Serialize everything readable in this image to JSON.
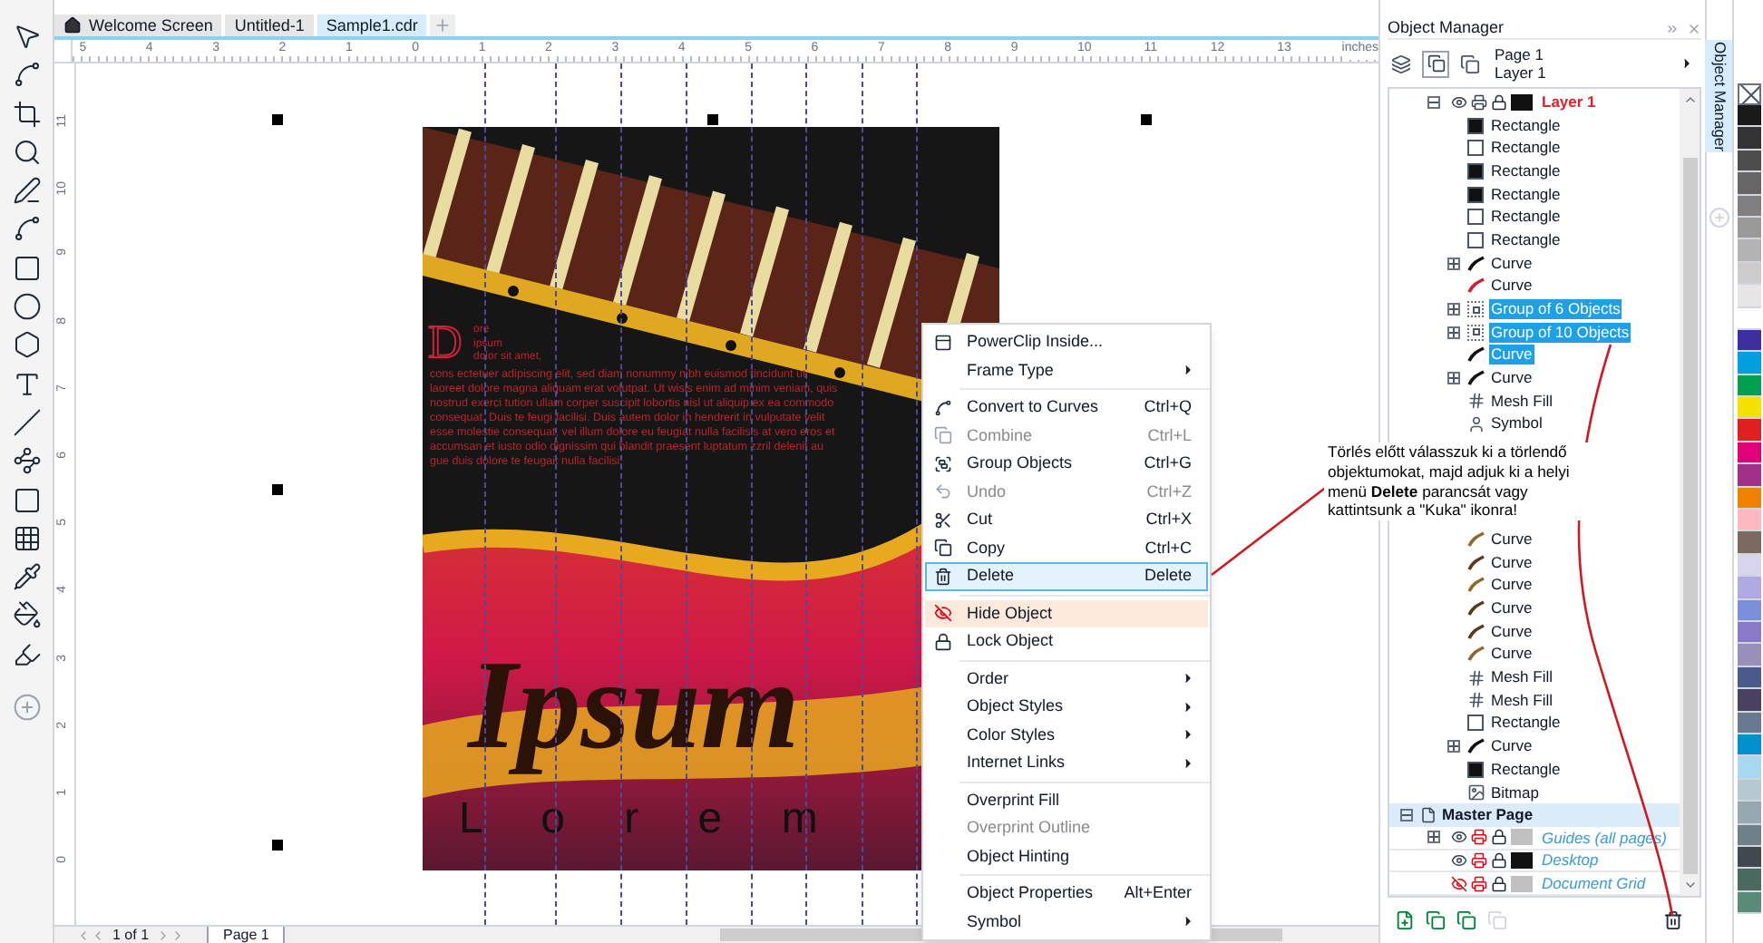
{
  "tabs": [
    {
      "label": "Welcome Screen",
      "selected": false
    },
    {
      "label": "Untitled-1",
      "selected": false
    },
    {
      "label": "Sample1.cdr",
      "selected": true
    }
  ],
  "ruler": {
    "horizontal": [
      "5",
      "4",
      "3",
      "2",
      "1",
      "0",
      "1",
      "2",
      "3",
      "4",
      "5",
      "6",
      "7",
      "8",
      "9",
      "10",
      "11",
      "12",
      "13"
    ],
    "unit": "inches",
    "vertical": [
      "11",
      "10",
      "9",
      "8",
      "7",
      "6",
      "5",
      "4",
      "3",
      "2",
      "1",
      "0"
    ]
  },
  "artwork": {
    "drop_cap": "D",
    "intro": [
      "ore",
      "ipsum",
      "dolor sit amet,"
    ],
    "body": "cons ectetuer adipiscing elit, sed diam nonummy nibh euismod tincidunt ut laoreet dolore magna aliquam erat volutpat. Ut wisis enim ad minim veniam, quis nostrud exerci tution ullam corper suscipit lobortis nisl ut aliquip ex ea commodo consequat. Duis te feugi facilisi. Duis autem dolor in hendrerit in vulputate velit esse molestie consequat, vel illum dolore eu feugiat nulla facilisis at vero eros et accumsan et iusto odio dignissim qui blandit praesent luptatum zzril delenit au gue duis dolore te feugait nulla facilisi.",
    "title": "Ipsum",
    "subtitle": "L o r e m"
  },
  "page_nav": {
    "count": "1 of 1",
    "page_tab": "Page 1"
  },
  "context_menu": [
    {
      "kind": "item",
      "label": "PowerClip Inside...",
      "submenu": false,
      "disabled": false,
      "selected": false,
      "hovered": false
    },
    {
      "kind": "item",
      "label": "Frame Type",
      "submenu": true,
      "disabled": false,
      "selected": false,
      "hovered": false
    },
    {
      "kind": "separator"
    },
    {
      "kind": "item",
      "label": "Convert to Curves",
      "shortcut": "Ctrl+Q",
      "submenu": false,
      "disabled": false,
      "selected": false,
      "hovered": false
    },
    {
      "kind": "item",
      "label": "Combine",
      "shortcut": "Ctrl+L",
      "submenu": false,
      "disabled": true,
      "selected": false,
      "hovered": false
    },
    {
      "kind": "item",
      "label": "Group Objects",
      "shortcut": "Ctrl+G",
      "submenu": false,
      "disabled": false,
      "selected": false,
      "hovered": false
    },
    {
      "kind": "item",
      "label": "Undo",
      "shortcut": "Ctrl+Z",
      "submenu": false,
      "disabled": true,
      "selected": false,
      "hovered": false
    },
    {
      "kind": "item",
      "label": "Cut",
      "shortcut": "Ctrl+X",
      "submenu": false,
      "disabled": false,
      "selected": false,
      "hovered": false
    },
    {
      "kind": "item",
      "label": "Copy",
      "shortcut": "Ctrl+C",
      "submenu": false,
      "disabled": false,
      "selected": false,
      "hovered": false
    },
    {
      "kind": "item",
      "label": "Delete",
      "shortcut": "Delete",
      "submenu": false,
      "disabled": false,
      "selected": true,
      "hovered": false
    },
    {
      "kind": "separator"
    },
    {
      "kind": "item",
      "label": "Hide Object",
      "submenu": false,
      "disabled": false,
      "selected": false,
      "hovered": true
    },
    {
      "kind": "item",
      "label": "Lock Object",
      "submenu": false,
      "disabled": false,
      "selected": false,
      "hovered": false
    },
    {
      "kind": "separator"
    },
    {
      "kind": "item",
      "label": "Order",
      "submenu": true,
      "disabled": false,
      "selected": false,
      "hovered": false
    },
    {
      "kind": "item",
      "label": "Object Styles",
      "submenu": true,
      "disabled": false,
      "selected": false,
      "hovered": false
    },
    {
      "kind": "item",
      "label": "Color Styles",
      "submenu": true,
      "disabled": false,
      "selected": false,
      "hovered": false
    },
    {
      "kind": "item",
      "label": "Internet Links",
      "submenu": true,
      "disabled": false,
      "selected": false,
      "hovered": false
    },
    {
      "kind": "separator"
    },
    {
      "kind": "item",
      "label": "Overprint Fill",
      "submenu": false,
      "disabled": false,
      "selected": false,
      "hovered": false
    },
    {
      "kind": "item",
      "label": "Overprint Outline",
      "submenu": false,
      "disabled": true,
      "selected": false,
      "hovered": false
    },
    {
      "kind": "item",
      "label": "Object Hinting",
      "submenu": false,
      "disabled": false,
      "selected": false,
      "hovered": false
    },
    {
      "kind": "separator"
    },
    {
      "kind": "item",
      "label": "Object Properties",
      "shortcut": "Alt+Enter",
      "submenu": false,
      "disabled": false,
      "selected": false,
      "hovered": false
    },
    {
      "kind": "item",
      "label": "Symbol",
      "submenu": true,
      "disabled": false,
      "selected": false,
      "hovered": false
    }
  ],
  "object_manager": {
    "title": "Object Manager",
    "page": "Page 1",
    "layer": "Layer 1",
    "tree": [
      {
        "kind": "layer",
        "label": "Layer 1",
        "active": true,
        "expanded": true,
        "visible": true,
        "color": "#111111",
        "selected": false,
        "children": [
          {
            "kind": "rectangle",
            "label": "Rectangle",
            "color": "#111111",
            "selected": false
          },
          {
            "kind": "rectangle",
            "label": "Rectangle",
            "color": "#ffffff",
            "selected": false
          },
          {
            "kind": "rectangle",
            "label": "Rectangle",
            "color": "#111111",
            "selected": false
          },
          {
            "kind": "rectangle",
            "label": "Rectangle",
            "color": "#111111",
            "selected": false
          },
          {
            "kind": "rectangle",
            "label": "Rectangle",
            "color": "#ffffff",
            "selected": false
          },
          {
            "kind": "rectangle",
            "label": "Rectangle",
            "color": "#ffffff",
            "selected": false
          },
          {
            "kind": "curve",
            "label": "Curve",
            "color": "#111111",
            "expanded": false,
            "selected": false
          },
          {
            "kind": "curve",
            "label": "Curve",
            "color": "#d02030",
            "selected": false
          },
          {
            "kind": "group",
            "label": "Group of 6 Objects",
            "expanded": false,
            "selected": true
          },
          {
            "kind": "group",
            "label": "Group of 10 Objects",
            "expanded": false,
            "selected": true
          },
          {
            "kind": "curve",
            "label": "Curve",
            "color": "#111111",
            "selected": true
          },
          {
            "kind": "curve",
            "label": "Curve",
            "color": "#111111",
            "expanded": false,
            "selected": false
          },
          {
            "kind": "mesh",
            "label": "Mesh Fill",
            "selected": false
          },
          {
            "kind": "symbol",
            "label": "Symbol",
            "selected": false
          },
          {
            "kind": "callout",
            "text": "Törlés előtt válasszuk ki a törlendő objektumokat, majd adjuk ki a helyi menü **Delete** parancsát vagy kattintsunk a \"Kuka\" ikonra!"
          },
          {
            "kind": "curve",
            "label": "Curve",
            "color": "#8a6a30",
            "selected": false
          },
          {
            "kind": "curve",
            "label": "Curve",
            "color": "#5a3a1a",
            "selected": false
          },
          {
            "kind": "curve",
            "label": "Curve",
            "color": "#8a6a30",
            "selected": false
          },
          {
            "kind": "curve",
            "label": "Curve",
            "color": "#5a3a1a",
            "selected": false
          },
          {
            "kind": "curve",
            "label": "Curve",
            "color": "#5a3a1a",
            "selected": false
          },
          {
            "kind": "curve",
            "label": "Curve",
            "color": "#8a6a30",
            "selected": false
          },
          {
            "kind": "mesh",
            "label": "Mesh Fill",
            "selected": false
          },
          {
            "kind": "mesh",
            "label": "Mesh Fill",
            "selected": false
          },
          {
            "kind": "rectangle",
            "label": "Rectangle",
            "color": "#ffffff",
            "selected": false
          },
          {
            "kind": "curve",
            "label": "Curve",
            "color": "#111111",
            "expanded": false,
            "selected": false
          },
          {
            "kind": "rectangle",
            "label": "Rectangle",
            "color": "#111111",
            "selected": false
          },
          {
            "kind": "bitmap",
            "label": "Bitmap",
            "selected": false
          }
        ]
      },
      {
        "kind": "page",
        "label": "Master Page",
        "expanded": true,
        "selected": false,
        "children": [
          {
            "kind": "master-layer",
            "label": "Guides (all pages)",
            "expanded": false,
            "visible": true,
            "color": "#c0c0c0",
            "selected": false
          },
          {
            "kind": "master-layer",
            "label": "Desktop",
            "visible": true,
            "color": "#111111",
            "selected": false
          },
          {
            "kind": "master-layer",
            "label": "Document Grid",
            "visible": false,
            "color": "#c0c0c0",
            "selected": false
          }
        ]
      }
    ]
  },
  "docker_tab": {
    "label": "Object Manager"
  },
  "palette": [
    {
      "color": "#1a1a1a"
    },
    {
      "color": "#333333"
    },
    {
      "color": "#4d4d4d"
    },
    {
      "color": "#666666"
    },
    {
      "color": "#808080"
    },
    {
      "color": "#999999"
    },
    {
      "color": "#b3b3b3"
    },
    {
      "color": "#cccccc"
    },
    {
      "color": "#e6e6e6"
    },
    {
      "color": "#ffffff"
    },
    {
      "color": "#3d2fa0"
    },
    {
      "color": "#00a0e0"
    },
    {
      "color": "#00a050"
    },
    {
      "color": "#f5e000"
    },
    {
      "color": "#e02020"
    },
    {
      "color": "#e0007a"
    },
    {
      "color": "#a0308a"
    },
    {
      "color": "#f08000"
    },
    {
      "color": "#ffb8c0"
    },
    {
      "color": "#7a6a60"
    },
    {
      "color": "#d8d4f0"
    },
    {
      "color": "#b0a8e0"
    },
    {
      "color": "#7a90d8"
    },
    {
      "color": "#8a78c8"
    },
    {
      "color": "#9890b8"
    },
    {
      "color": "#4a5a8a"
    },
    {
      "color": "#4a4060"
    },
    {
      "color": "#6a7890"
    },
    {
      "color": "#0090d0"
    },
    {
      "color": "#a8d8f0"
    },
    {
      "color": "#b8c8d0"
    },
    {
      "color": "#98a8b0"
    },
    {
      "color": "#708088"
    },
    {
      "color": "#404850"
    },
    {
      "color": "#4a6a60"
    },
    {
      "color": "#5a8a78"
    }
  ]
}
